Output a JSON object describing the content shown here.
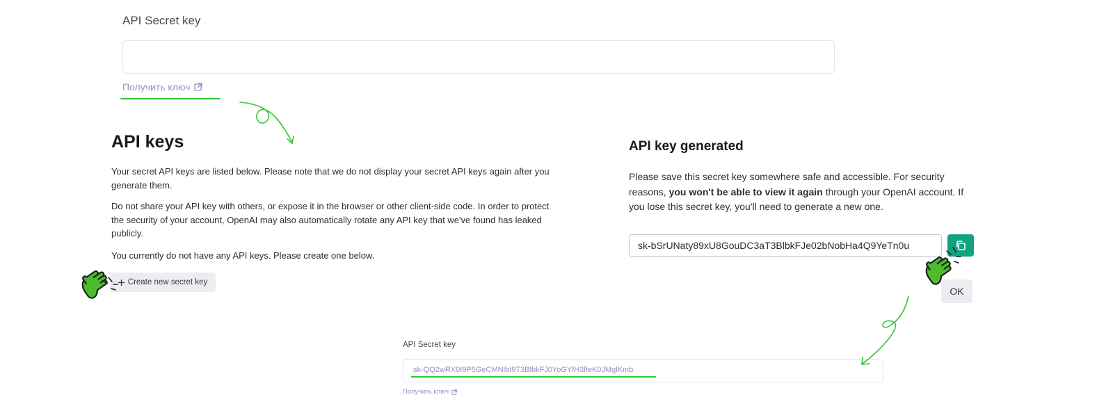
{
  "top": {
    "label": "API Secret key",
    "link": "Получить ключ"
  },
  "keys_panel": {
    "title": "API keys",
    "p1": "Your secret API keys are listed below. Please note that we do not display your secret API keys again after you generate them.",
    "p2": "Do not share your API key with others, or expose it in the browser or other client-side code. In order to protect the security of your account, OpenAI may also automatically rotate any API key that we've found has leaked publicly.",
    "p3": "You currently do not have any API keys. Please create one below.",
    "create_button": "Create new secret key"
  },
  "generated_panel": {
    "title": "API key generated",
    "para_before": "Please save this secret key somewhere safe and accessible. For security reasons, ",
    "para_bold": "you won't be able to view it again",
    "para_after": " through your OpenAI account. If you lose this secret key, you'll need to generate a new one.",
    "key_value": "sk-bSrUNaty89xU8GouDC3aT3BlbkFJe02bNobHa4Q9YeTn0u",
    "ok_button": "OK"
  },
  "bottom": {
    "label": "API Secret key",
    "key_value": "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",
    "link": "Получить ключ"
  },
  "colors": {
    "accent_green": "#33c633",
    "copy_button": "#10a37f",
    "link_purple": "#a08ac4",
    "hand_fill": "#4cbc2c"
  },
  "icons": [
    "external-link-icon",
    "plus-icon",
    "copy-icon",
    "pointing-hand-icon",
    "arrow-icon"
  ]
}
